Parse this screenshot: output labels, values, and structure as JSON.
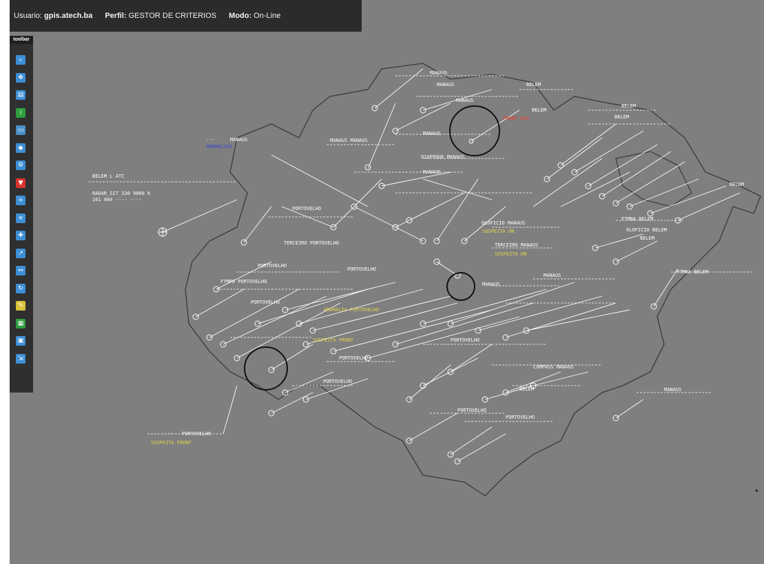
{
  "status": {
    "user_label": "Usuario:",
    "user_value": "gpis.atech.ba",
    "profile_label": "Perfil:",
    "profile_value": "GESTOR DE CRITERIOS",
    "mode_label": "Modo:",
    "mode_value": "On-Line"
  },
  "toolbar": {
    "title": "toolbar",
    "buttons": [
      {
        "icon": "search-icon",
        "color": "#3d8fd6"
      },
      {
        "icon": "pan-icon",
        "color": "#3d8fd6"
      },
      {
        "icon": "layers-icon",
        "color": "#3d8fd6"
      },
      {
        "icon": "info-icon",
        "color": "#2e9f3e"
      },
      {
        "icon": "window-icon",
        "color": "#4a90c8"
      },
      {
        "icon": "shape-icon",
        "color": "#3d8fd6"
      },
      {
        "icon": "gear-icon",
        "color": "#3d8fd6"
      },
      {
        "icon": "filter-icon",
        "color": "#d8342a"
      },
      {
        "icon": "add-track-icon",
        "color": "#3d8fd6"
      },
      {
        "icon": "remove-track-icon",
        "color": "#3d8fd6"
      },
      {
        "icon": "add-point-icon",
        "color": "#3d8fd6"
      },
      {
        "icon": "route-icon",
        "color": "#3d8fd6"
      },
      {
        "icon": "measure-icon",
        "color": "#3d8fd6"
      },
      {
        "icon": "refresh-icon",
        "color": "#3d8fd6"
      },
      {
        "icon": "pencil-icon",
        "color": "#d8c33a"
      },
      {
        "icon": "grid-icon",
        "color": "#2e9f3e"
      },
      {
        "icon": "print-icon",
        "color": "#3d8fd6"
      },
      {
        "icon": "export-icon",
        "color": "#3d8fd6"
      }
    ]
  },
  "map_labels": {
    "belem_ati": "BELEM      L    ATC",
    "radar_line": "RADAR_SIT  330 9000 K",
    "code_line": "161  884   ----  ----",
    "portovelho_1": "PORTOVELHO",
    "portovelho_2": "PORTOVELHO",
    "portovelho_3": "PORTOVELHO",
    "portovelho_4": "PORTOVELHO",
    "portovelho_5": "PORTOVELHO",
    "portovelho_6": "PORTOVELHO",
    "portovelho_7": "PORTOVELHO",
    "portovelho_8": "PORTOVELHO",
    "portovelho_9": "PORTOVELHO",
    "portovelho_bottom": "PORTOVELHO",
    "fimpo_portovelho": "FTMPO  PORTOVELHO",
    "terceiro_portovelho": "TERCEIRO PORTOVELHO",
    "manaus_1": "MANAUS",
    "manaus_2": "MANAUS",
    "manaus_3": "MANAUS",
    "manaus_4": "MANAUS",
    "manaus_5": "MANAUS",
    "manaus_6": "MANAUS",
    "manaus_7": "MANAUS",
    "manaus_8": "MANAUS",
    "manaus_far": "MANAUS",
    "belem_1": "BELEM",
    "belem_2": "BELEM",
    "belem_3": "BELEM",
    "belem_4": "BELEM",
    "belem_5": "BELEM",
    "belem_6": "BELEM",
    "ftmna_belem": "FTMNA  BELEM",
    "ftmna_belem_2": "FTMNA  BELEM",
    "terceiro_manaus": "TERCEIRO MANAUS",
    "oficial_manaus": "OLOFICIO MANAUS",
    "oficial_belem": "OLOFICIO BELEM",
    "anomalia": "ANOMALIAS",
    "suspeita_1": "SUSPEITA ON",
    "suspeita_2": "SUSPEITA ON",
    "suspeita_front_1": "SUSPEITA FRONT",
    "suspeita_front_2": "SUSPEITA FRONT",
    "front_013": "FRONT 013",
    "dashes": "----",
    "dashes_2": "---",
    "tracks_detail": "COMPASS MANAUS",
    "yellow_center": "ANOMALIA PORTOVELHO",
    "manaus_cluster": "MANAUS  MANAUS",
    "oiapoque_manaus": "OIAPOQUE MANAUS",
    "belem_right": "BELEM"
  },
  "colors": {
    "background": "#7f7f7f",
    "status_bar": "#2b2b2b",
    "toolbar": "#2f2f2f",
    "track_white": "#ffffff",
    "warning_yellow": "#e6d64a",
    "alert_red": "#ff3a2a",
    "note_blue": "#3347d6",
    "border_line": "#3a3a3a"
  }
}
